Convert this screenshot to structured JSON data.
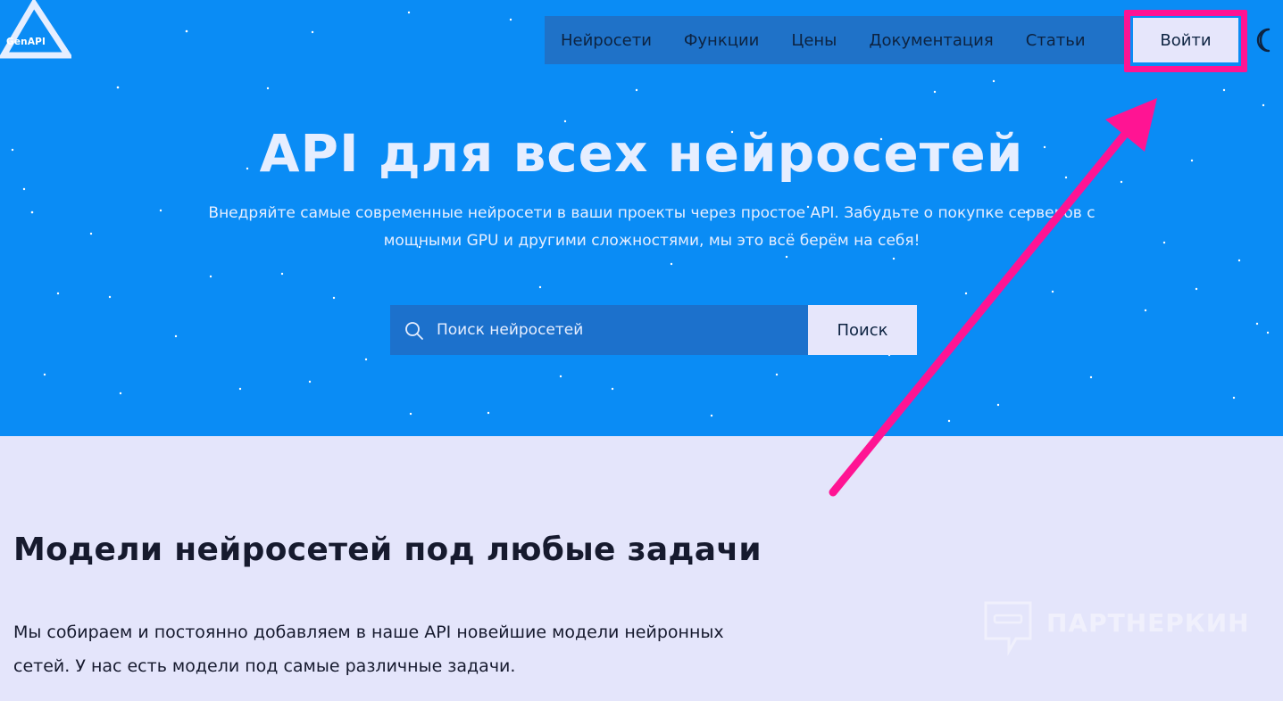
{
  "logo": {
    "text": "GenAPI"
  },
  "nav": {
    "items": [
      {
        "label": "Нейросети"
      },
      {
        "label": "Функции"
      },
      {
        "label": "Цены"
      },
      {
        "label": "Документация"
      },
      {
        "label": "Статьи"
      }
    ],
    "login_label": "Войти",
    "theme_icon": "moon-icon"
  },
  "hero": {
    "title": "API для всех нейросетей",
    "subtitle": "Внедряйте самые современные нейросети в ваши проекты через простое API. Забудьте о покупке серверов с мощными GPU и другими сложностями, мы это всё берём на себя!"
  },
  "search": {
    "placeholder": "Поиск нейросетей",
    "button_label": "Поиск",
    "icon": "search-icon"
  },
  "section": {
    "title": "Модели нейросетей под любые задачи",
    "text": "Мы собираем и постоянно добавляем в наше API новейшие модели нейронных сетей. У нас есть модели под самые различные задачи."
  },
  "watermark": {
    "text": "ПАРТНЕРКИН"
  },
  "colors": {
    "hero_bg": "#0a8cf5",
    "nav_bg": "#1f72c8",
    "highlight": "#ff1493",
    "page_bg": "#e4e5fb"
  }
}
